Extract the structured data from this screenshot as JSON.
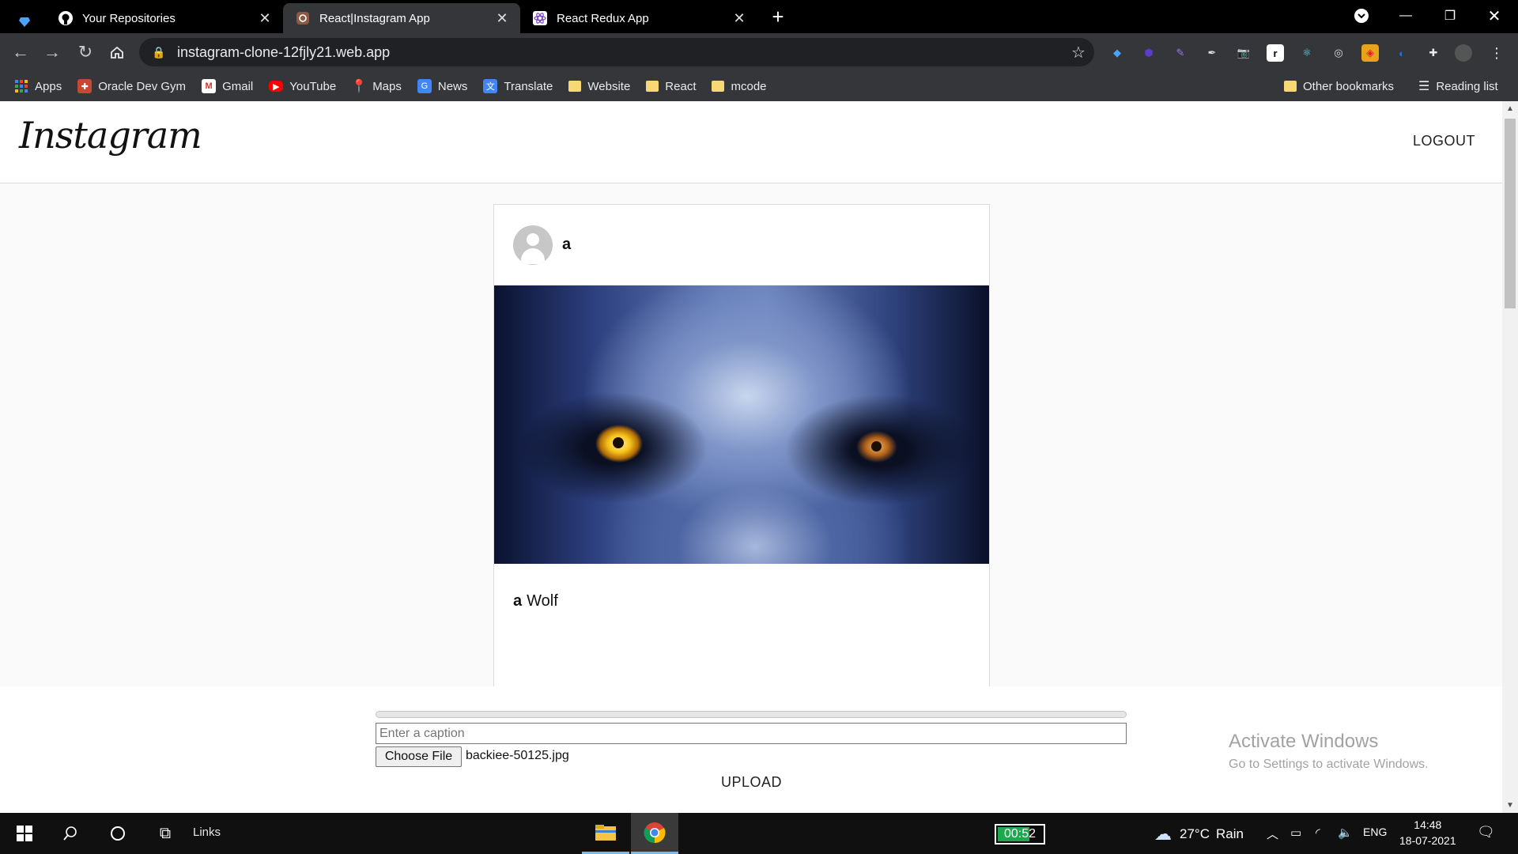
{
  "browser": {
    "tabs": [
      {
        "title": "Your Repositories",
        "icon": "github-icon",
        "active": false
      },
      {
        "title": "React|Instagram App",
        "icon": "instagram-icon",
        "active": true
      },
      {
        "title": "React Redux App",
        "icon": "react-icon",
        "active": false
      }
    ],
    "url": "instagram-clone-12fjly21.web.app",
    "bookmarks": [
      {
        "label": "Apps",
        "icon": "apps-grid-icon"
      },
      {
        "label": "Oracle Dev Gym",
        "icon": "oracle-icon"
      },
      {
        "label": "Gmail",
        "icon": "gmail-icon"
      },
      {
        "label": "YouTube",
        "icon": "youtube-icon"
      },
      {
        "label": "Maps",
        "icon": "maps-icon"
      },
      {
        "label": "News",
        "icon": "news-icon"
      },
      {
        "label": "Translate",
        "icon": "translate-icon"
      },
      {
        "label": "Website",
        "icon": "folder-icon"
      },
      {
        "label": "React",
        "icon": "folder-icon"
      },
      {
        "label": "mcode",
        "icon": "folder-icon"
      }
    ],
    "other_bookmarks": "Other bookmarks",
    "reading_list": "Reading list"
  },
  "app": {
    "logo": "Instagram",
    "logout_label": "LOGOUT",
    "post": {
      "username": "a",
      "caption_user": "a",
      "caption_text": "Wolf",
      "image_subject": "wolf-eyes-image"
    },
    "upload": {
      "caption_placeholder": "Enter a caption",
      "choose_file_label": "Choose File",
      "file_name": "backiee-50125.jpg",
      "upload_label": "UPLOAD",
      "progress": 0
    }
  },
  "watermark": {
    "title": "Activate Windows",
    "subtitle": "Go to Settings to activate Windows."
  },
  "taskbar": {
    "links_label": "Links",
    "timer": "00:52",
    "weather_temp": "27°C",
    "weather_desc": "Rain",
    "language": "ENG",
    "time": "14:48",
    "date": "18-07-2021"
  },
  "colors": {
    "chrome_dark": "#35363a",
    "tabstrip": "#000000",
    "page_bg": "#fafafa",
    "border": "#dbdbdb",
    "taskbar": "#101010",
    "timer_green": "#1ea84d"
  }
}
